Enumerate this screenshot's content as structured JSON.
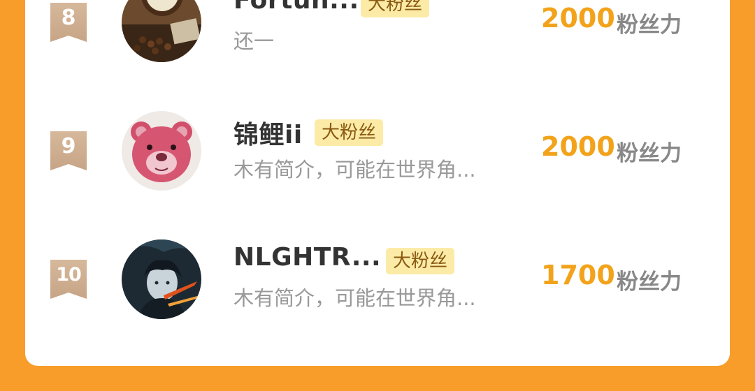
{
  "colors": {
    "background": "#F89C2A",
    "score": "#F2A31B",
    "badge_bg": "#FCEBA7",
    "rank_badge": "#CDAE92"
  },
  "ranking": [
    {
      "rank": "8",
      "name": "Fortun...",
      "badge": "大粉丝",
      "bio": "还一",
      "score": "2000",
      "unit": "粉丝力",
      "avatar_icon": "clock-photo-avatar"
    },
    {
      "rank": "9",
      "name": "锦鲤ii",
      "badge": "大粉丝",
      "bio": "木有简介，可能在世界角...",
      "score": "2000",
      "unit": "粉丝力",
      "avatar_icon": "pink-bear-avatar"
    },
    {
      "rank": "10",
      "name": "NLGHTR...",
      "badge": "大粉丝",
      "bio": "木有简介，可能在世界角...",
      "score": "1700",
      "unit": "粉丝力",
      "avatar_icon": "anime-character-avatar"
    }
  ]
}
